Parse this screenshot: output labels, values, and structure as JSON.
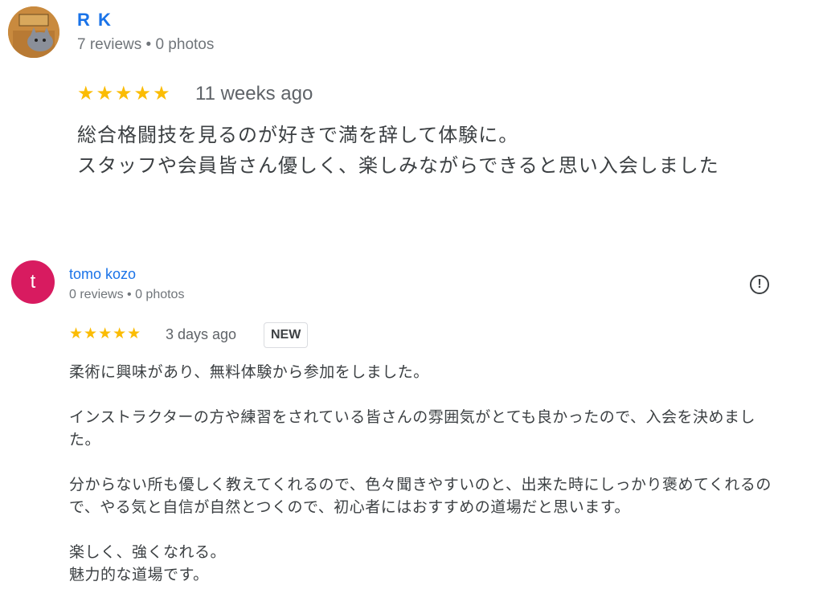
{
  "reviews": [
    {
      "author": "R K",
      "meta": "7 reviews • 0 photos",
      "rating": 5,
      "stars": "★★★★★",
      "time": "11 weeks ago",
      "text_lines": [
        "総合格闘技を見るのが好きで満を辞して体験に。",
        "スタッフや会員皆さん優しく、楽しみながらできると思い入会しました"
      ]
    },
    {
      "author": "tomo kozo",
      "avatar_letter": "t",
      "avatar_color": "#d81b60",
      "meta": "0 reviews • 0 photos",
      "rating": 5,
      "stars": "★★★★★",
      "time": "3 days ago",
      "badge": "NEW",
      "flag_icon": "!",
      "paragraphs": [
        "柔術に興味があり、無料体験から参加をしました。",
        "インストラクターの方や練習をされている皆さんの雰囲気がとても良かったので、入会を決めました。",
        "分からない所も優しく教えてくれるので、色々聞きやすいのと、出来た時にしっかり褒めてくれるので、やる気と自信が自然とつくので、初心者にはおすすめの道場だと思います。",
        "楽しく、強くなれる。",
        "魅力的な道場です。"
      ]
    }
  ],
  "colors": {
    "author_link": "#1a73e8",
    "star": "#fbbc04",
    "meta": "#70757a"
  }
}
